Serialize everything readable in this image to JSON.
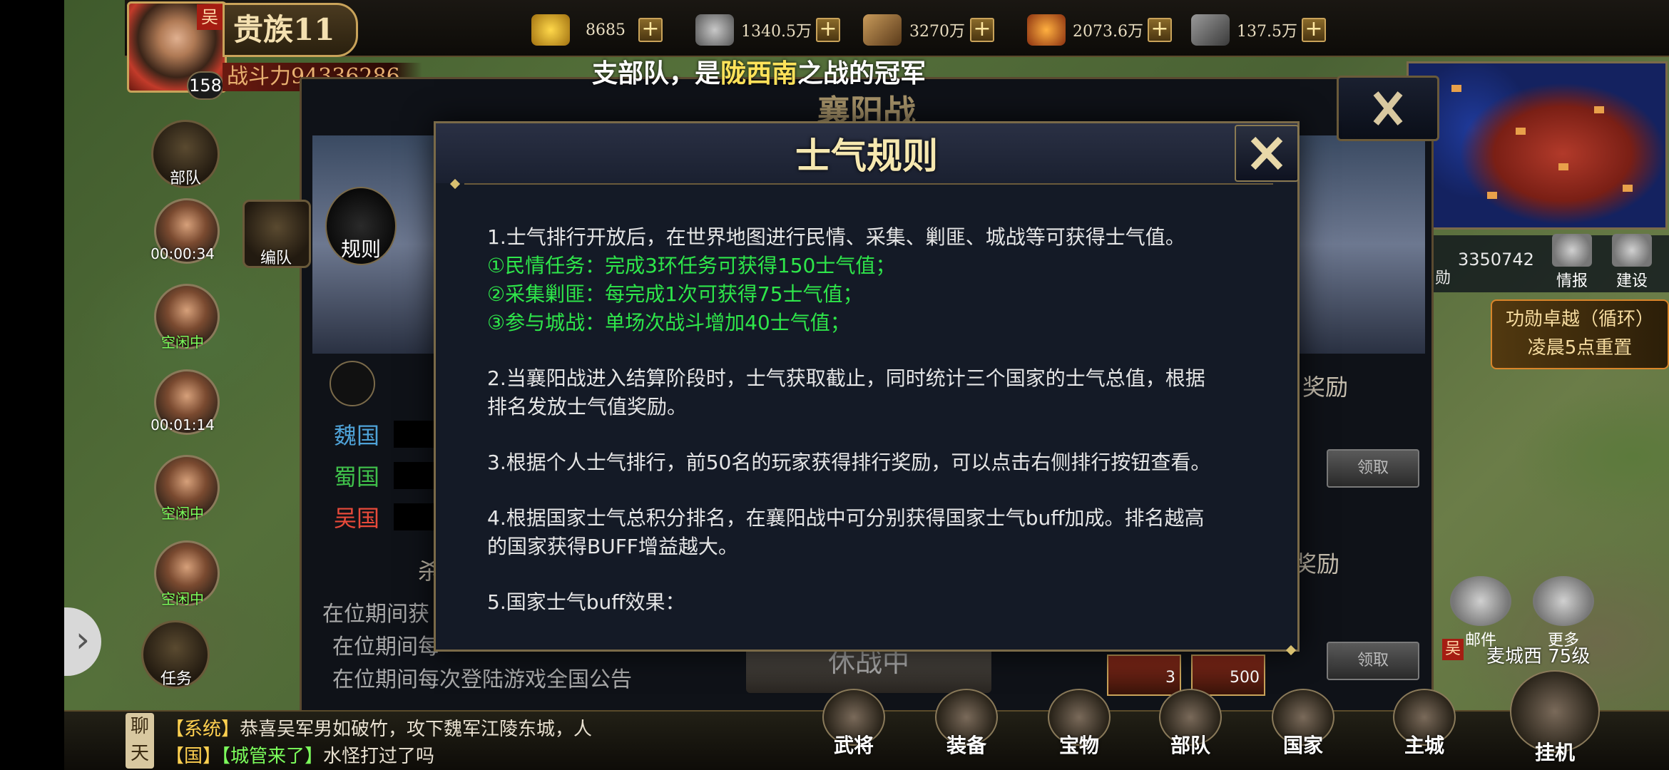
{
  "top_bar": {
    "resources": [
      {
        "icon": "gold-ingot-icon",
        "value": "8685"
      },
      {
        "icon": "coin-icon",
        "value": "1340.5万"
      },
      {
        "icon": "wood-icon",
        "value": "3270万"
      },
      {
        "icon": "food-icon",
        "value": "2073.6万"
      },
      {
        "icon": "iron-icon",
        "value": "137.5万"
      }
    ],
    "plus_label": "+"
  },
  "player": {
    "nation_flag": "吴",
    "level": "158",
    "rank": "贵族11",
    "power": "战斗力94336286"
  },
  "marquee": {
    "prefix": "支部队，是",
    "highlight": "陇西南",
    "suffix": "之战的冠军"
  },
  "left_column": {
    "troops_label": "部队",
    "formation_label": "编队",
    "task_label": "任务",
    "heroes": [
      {
        "status": "00:00:34",
        "kind": "timer"
      },
      {
        "status": "空闲中",
        "kind": "idle"
      },
      {
        "status": "00:01:14",
        "kind": "timer"
      },
      {
        "status": "空闲中",
        "kind": "idle"
      },
      {
        "status": "空闲中",
        "kind": "idle"
      }
    ],
    "expand_glyph": "›"
  },
  "right_panel": {
    "merit_value": "3350742",
    "merit_label_partial": "勋",
    "intel_label": "情报",
    "build_label": "建设",
    "event_title": "功勋卓越（循环）",
    "event_sub": "凌晨5点重置",
    "mail_label": "邮件",
    "more_label": "更多",
    "city_nation": "吴",
    "city_name": "麦城西 75级"
  },
  "chat": {
    "tag": "聊天",
    "line1_channel": "【系统】",
    "line1_text": "恭喜吴军男如破竹，攻下魏军江陵东城，人",
    "line2_channel": "【国】",
    "line2_name": "【城管来了】",
    "line2_text": "水怪打过了吗"
  },
  "bottom_nav": [
    "武将",
    "装备",
    "宝物",
    "部队",
    "国家",
    "主城",
    "挂机"
  ],
  "bg_dialog": {
    "title": "襄阳战",
    "rule_label": "规则",
    "nations": [
      {
        "name": "魏国",
        "color": "#4fa3d8"
      },
      {
        "name": "蜀国",
        "color": "#3fbf4a"
      },
      {
        "name": "吴国",
        "color": "#e84a3a"
      }
    ],
    "reward_label_1": "奖励",
    "reward_label_2": "奖励",
    "kill_partial": "杀",
    "claim_label": "领取",
    "tips": [
      "在位期间获",
      "在位期间每",
      "在位期间每次登陆游戏全国公告"
    ],
    "peace_label": "休战中",
    "item_counts": [
      "3",
      "500"
    ]
  },
  "dialog": {
    "title": "士气规则",
    "rules": [
      {
        "lines": [
          {
            "text": "1.士气排行开放后，在世界地图进行民情、采集、剿匪、城战等可获得士气值。",
            "green": false
          },
          {
            "text": "①民情任务：完成3环任务可获得150士气值；",
            "green": true
          },
          {
            "text": "②采集剿匪：每完成1次可获得75士气值；",
            "green": true
          },
          {
            "text": "③参与城战：单场次战斗增加40士气值；",
            "green": true
          }
        ]
      },
      {
        "lines": [
          {
            "text": "2.当襄阳战进入结算阶段时，士气获取截止，同时统计三个国家的士气总值，根据",
            "green": false
          },
          {
            "text": "排名发放士气值奖励。",
            "green": false
          }
        ]
      },
      {
        "lines": [
          {
            "text": "3.根据个人士气排行，前50名的玩家获得排行奖励，可以点击右侧排行按钮查看。",
            "green": false
          }
        ]
      },
      {
        "lines": [
          {
            "text": "4.根据国家士气总积分排名，在襄阳战中可分别获得国家士气buff加成。排名越高",
            "green": false
          },
          {
            "text": "的国家获得BUFF增益越大。",
            "green": false
          }
        ]
      },
      {
        "lines": [
          {
            "text": "5.国家士气buff效果：",
            "green": false
          }
        ]
      }
    ]
  },
  "colors": {
    "accent_gold": "#c9a35a",
    "green_text": "#2ee64a",
    "dialog_bg": "#141a26"
  }
}
